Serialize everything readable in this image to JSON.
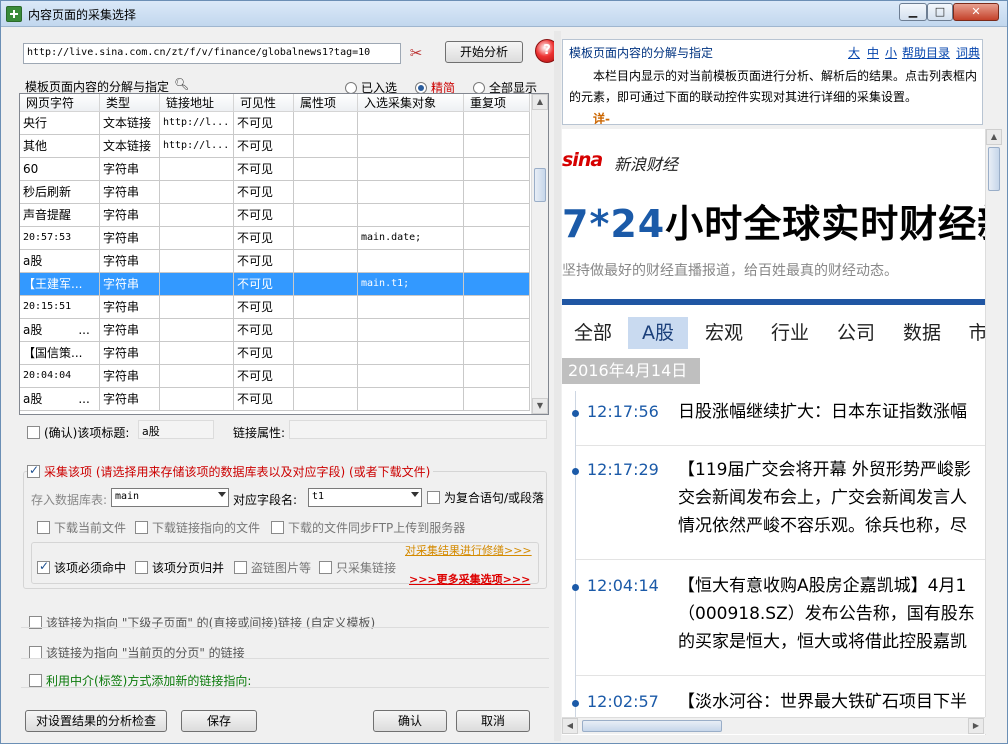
{
  "window": {
    "title": "内容页面的采集选择",
    "min": "▁",
    "max": "□",
    "close": "✕"
  },
  "toolbar": {
    "url": "http://live.sina.com.cn/zt/f/v/finance/globalnews1?tag=10",
    "analyze_label": "开始分析",
    "help_glyph": "?"
  },
  "list": {
    "label": "模板页面内容的分解与指定",
    "radios": [
      {
        "label": "已入选",
        "checked": false
      },
      {
        "label": "精简",
        "checked": true
      },
      {
        "label": "全部显示",
        "checked": false
      }
    ],
    "columns": [
      "网页字符",
      "类型",
      "链接地址",
      "可见性",
      "属性项",
      "入选采集对象",
      "重复项"
    ],
    "rows": [
      {
        "text": "央行",
        "type": "文本链接",
        "link": "http://l...",
        "visible": "不可见",
        "attr": "",
        "target": "",
        "repeat": ""
      },
      {
        "text": "其他",
        "type": "文本链接",
        "link": "http://l...",
        "visible": "不可见",
        "attr": "",
        "target": "",
        "repeat": ""
      },
      {
        "text": "60",
        "type": "字符串",
        "link": "",
        "visible": "不可见",
        "attr": "",
        "target": "",
        "repeat": ""
      },
      {
        "text": "秒后刷新",
        "type": "字符串",
        "link": "",
        "visible": "不可见",
        "attr": "",
        "target": "",
        "repeat": ""
      },
      {
        "text": "声音提醒",
        "type": "字符串",
        "link": "",
        "visible": "不可见",
        "attr": "",
        "target": "",
        "repeat": ""
      },
      {
        "text": "20:57:53",
        "type": "字符串",
        "link": "",
        "visible": "不可见",
        "attr": "",
        "target": "main.date;",
        "repeat": ""
      },
      {
        "text": "a股",
        "type": "字符串",
        "link": "",
        "visible": "不可见",
        "attr": "",
        "target": "",
        "repeat": ""
      },
      {
        "text": "【王建军...",
        "type": "字符串",
        "link": "",
        "visible": "不可见",
        "attr": "",
        "target": "main.t1;",
        "repeat": ""
      },
      {
        "text": "20:15:51",
        "type": "字符串",
        "link": "",
        "visible": "不可见",
        "attr": "",
        "target": "",
        "repeat": ""
      },
      {
        "text": "a股　　　...",
        "type": "字符串",
        "link": "",
        "visible": "不可见",
        "attr": "",
        "target": "",
        "repeat": ""
      },
      {
        "text": "【国信策...",
        "type": "字符串",
        "link": "",
        "visible": "不可见",
        "attr": "",
        "target": "",
        "repeat": ""
      },
      {
        "text": "20:04:04",
        "type": "字符串",
        "link": "",
        "visible": "不可见",
        "attr": "",
        "target": "",
        "repeat": ""
      },
      {
        "text": "a股　　　...",
        "type": "字符串",
        "link": "",
        "visible": "不可见",
        "attr": "",
        "target": "",
        "repeat": ""
      }
    ],
    "selected_row": 7
  },
  "item": {
    "confirm_label": "(确认)该项标题:",
    "title_value": "a股",
    "link_attr_label": "链接属性:",
    "link_attr_value": ""
  },
  "collect": {
    "label": "采集该项 (请选择用来存储该项的数据库表以及对应字段) (或者下载文件)",
    "db_label": "存入数据库表:",
    "db_value": "main",
    "field_label": "对应字段名:",
    "field_value": "t1",
    "compound_label": "为复合语句/或段落",
    "dl_current_label": "下载当前文件",
    "dl_linked_label": "下载链接指向的文件",
    "ftp_label": "下载的文件同步FTP上传到服务器",
    "must_label": "该项必须命中",
    "paging_label": "该项分页归并",
    "steal_label": "盗链图片等",
    "onlylinks_label": "只采集链接",
    "modify_link": "对采集结果进行修缮>>>",
    "more_link": ">>>更多采集选项>>>"
  },
  "link_opts": {
    "child_label": "该链接为指向 \"下级子页面\" 的(直接或间接)链接 (自定义模板)",
    "paging_label": "该链接为指向 \"当前页的分页\" 的链接",
    "tag_label": "利用中介(标签)方式添加新的链接指向:"
  },
  "buttons": {
    "check": "对设置结果的分析检查",
    "save": "保存",
    "ok": "确认",
    "cancel": "取消"
  },
  "help": {
    "title": "模板页面内容的分解与指定",
    "links": [
      "大",
      "中",
      "小",
      "帮助目录",
      "词典"
    ],
    "text": "本栏目内显示的对当前模板页面进行分析、解析后的结果。点击列表框内的元素，即可通过下面的联动控件实现对其进行详细的采集设置。",
    "more": "详-"
  },
  "browser": {
    "logo": "sina",
    "site_name": "新浪财经",
    "headline_blue": "7*24",
    "headline_rest": "小时全球实时财经新",
    "slogan": "坚持做最好的财经直播报道，给百姓最真的财经动态。",
    "tabs": [
      "全部",
      "A股",
      "宏观",
      "行业",
      "公司",
      "数据",
      "市"
    ],
    "active_tab": 1,
    "date": "2016年4月14日",
    "news": [
      {
        "time": "12:17:56",
        "lines": [
          "日股涨幅继续扩大：日本东证指数涨幅"
        ]
      },
      {
        "time": "12:17:29",
        "lines": [
          "【119届广交会将开幕 外贸形势严峻影",
          "交会新闻发布会上，广交会新闻发言人",
          "情况依然严峻不容乐观。徐兵也称，尽"
        ]
      },
      {
        "time": "12:04:14",
        "lines": [
          "【恒大有意收购A股房企嘉凯城】4月1",
          "（000918.SZ）发布公告称，国有股东",
          "的买家是恒大，恒大或将借此控股嘉凯"
        ]
      },
      {
        "time": "12:02:57",
        "lines": [
          "【淡水河谷：世界最大铁矿石项目下半"
        ]
      }
    ]
  },
  "colors": {
    "selection": "#3399ff",
    "accent_blue": "#1b5aa8",
    "red": "#cc0000",
    "sina_red": "#d60000"
  }
}
